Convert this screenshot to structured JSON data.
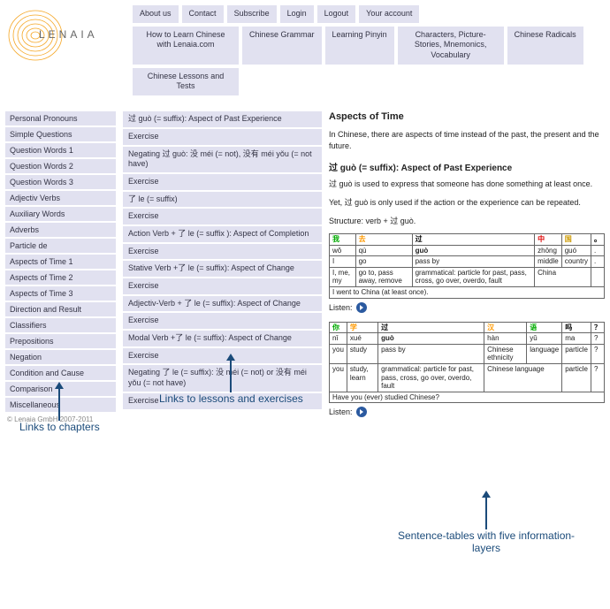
{
  "logo_text": "LENAIA",
  "top_nav": [
    "About us",
    "Contact",
    "Subscribe",
    "Login",
    "Logout",
    "Your account"
  ],
  "main_nav": [
    "How to Learn Chinese with Lenaia.com",
    "Chinese Grammar",
    "Learning Pinyin",
    "Characters, Picture-Stories, Mnemonics, Vocabulary",
    "Chinese Radicals",
    "Chinese Lessons and Tests"
  ],
  "sidebar": [
    "Personal Pronouns",
    "Simple Questions",
    "Question Words 1",
    "Question Words 2",
    "Question Words 3",
    "Adjectiv Verbs",
    "Auxiliary Words",
    "Adverbs",
    "Particle de",
    "Aspects of Time 1",
    "Aspects of Time 2",
    "Aspects of Time 3",
    "Direction and Result",
    "Classifiers",
    "Prepositions",
    "Negation",
    "Condition and Cause",
    "Comparison",
    "Miscellaneous"
  ],
  "copyright": "© Lenaia GmbH 2007-2011",
  "lessons": [
    "过 guò (= suffix): Aspect of Past Experience",
    "Exercise",
    "Negating 过 guò: 没 méi (= not), 没有 méi yǒu (= not have)",
    "Exercise",
    "了 le (= suffix)",
    "Exercise",
    "Action Verb + 了 le (= suffix ): Aspect of Completion",
    "Exercise",
    "Stative Verb +了 le (= suffix): Aspect of Change",
    "Exercise",
    "Adjectiv-Verb + 了 le (= suffix): Aspect of Change",
    "Exercise",
    "Modal Verb +了 le (= suffix): Aspect of Change",
    "Exercise",
    "Negating 了 le (= suffix): 没 méi (= not) or 没有 méi yǒu (= not have)",
    "Exercise"
  ],
  "content": {
    "title": "Aspects of Time",
    "intro": "In Chinese, there are aspects of time instead of the past, the present and the future.",
    "subtitle": "过 guò (= suffix): Aspect of Past Experience",
    "p1": "过 guò is used to express that someone has done something at least once.",
    "p2": "Yet, 过 guò is only used if the action or the experience can be repeated.",
    "structure": "Structure: verb + 过 guò.",
    "listen": "Listen:"
  },
  "chart_data": {
    "type": "table",
    "tables": [
      {
        "hanzi": [
          {
            "char": "我",
            "color": "g"
          },
          {
            "char": "去",
            "color": "o"
          },
          {
            "char": "过",
            "color": "k"
          },
          {
            "char": "中",
            "color": "r"
          },
          {
            "char": "国",
            "color": "b"
          },
          {
            "char": "。",
            "color": "k"
          }
        ],
        "pinyin": [
          "wǒ",
          "qù",
          "guò",
          "zhōng",
          "guó",
          "."
        ],
        "gloss": [
          "I",
          "go",
          "pass by",
          "middle",
          "country",
          "."
        ],
        "gloss2": [
          "I, me, my",
          "go to, pass away, remove",
          "grammatical: particle for past, pass, cross, go over, overdo, fault",
          "China",
          "",
          ""
        ],
        "merge2": [
          [
            0
          ],
          [
            1
          ],
          [
            2
          ],
          [
            3,
            4
          ],
          [
            5
          ]
        ],
        "sentence": "I went to China (at least once)."
      },
      {
        "hanzi": [
          {
            "char": "你",
            "color": "g"
          },
          {
            "char": "学",
            "color": "o"
          },
          {
            "char": "过",
            "color": "k"
          },
          {
            "char": "汉",
            "color": "o"
          },
          {
            "char": "语",
            "color": "g"
          },
          {
            "char": "吗",
            "color": "k"
          },
          {
            "char": "？",
            "color": "k"
          }
        ],
        "pinyin": [
          "nǐ",
          "xué",
          "guò",
          "hàn",
          "yǔ",
          "ma",
          "?"
        ],
        "gloss": [
          "you",
          "study",
          "pass by",
          "Chinese ethnicity",
          "language",
          "particle",
          "?"
        ],
        "gloss2": [
          "you",
          "study, learn",
          "grammatical: particle for past, pass, cross, go over, overdo, fault",
          "Chinese language",
          "",
          "particle",
          "?"
        ],
        "merge2": [
          [
            0
          ],
          [
            1
          ],
          [
            2
          ],
          [
            3,
            4
          ],
          [
            5
          ],
          [
            6
          ]
        ],
        "sentence": "Have you (ever) studied Chinese?"
      }
    ]
  },
  "annotations": {
    "sidebar": "Links to chapters",
    "lessons": "Links to lessons and exercises",
    "content": "Sentence-tables with five information-layers"
  }
}
